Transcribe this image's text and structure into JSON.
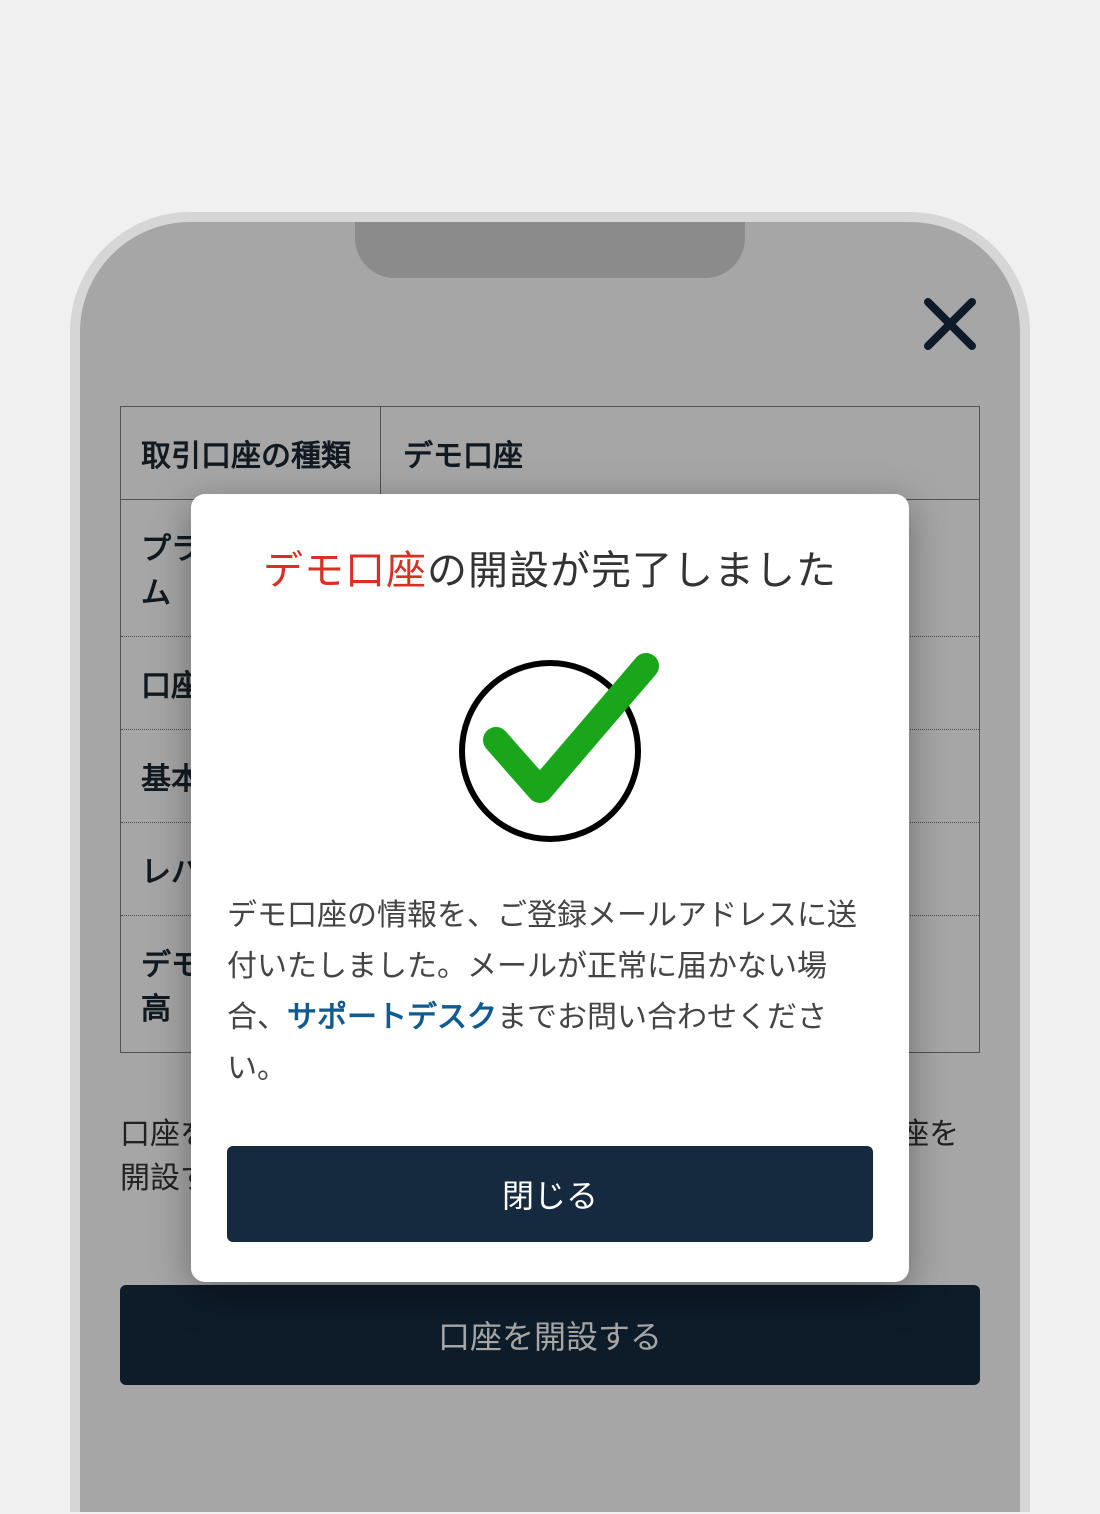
{
  "modal": {
    "title_red": "デモ口座",
    "title_rest": "の開設が完了しました",
    "body_before_link": "デモ口座の情報を、ご登録メールアドレスに送付いたしました。メールが正常に届かない場合、",
    "link_text": "サポートデスク",
    "body_after_link": "までお問い合わせください。",
    "close_label": "閉じる"
  },
  "background": {
    "table": {
      "head_label": "取引口座の種類",
      "head_value": "デモ口座",
      "rows": {
        "platform": {
          "label": "プラットフォーム"
        },
        "account_type": {
          "label": "口座タイプ"
        },
        "base": {
          "label": "基本通貨"
        },
        "leverage": {
          "label": "レバレッジ"
        },
        "demo_initial": {
          "label": "デモ口座初期残高"
        }
      }
    },
    "helper_text": "口座を開設するボタンを押すことで関連規約に同意し、口座を開設す",
    "primary_button_label": "口座を開設する"
  }
}
